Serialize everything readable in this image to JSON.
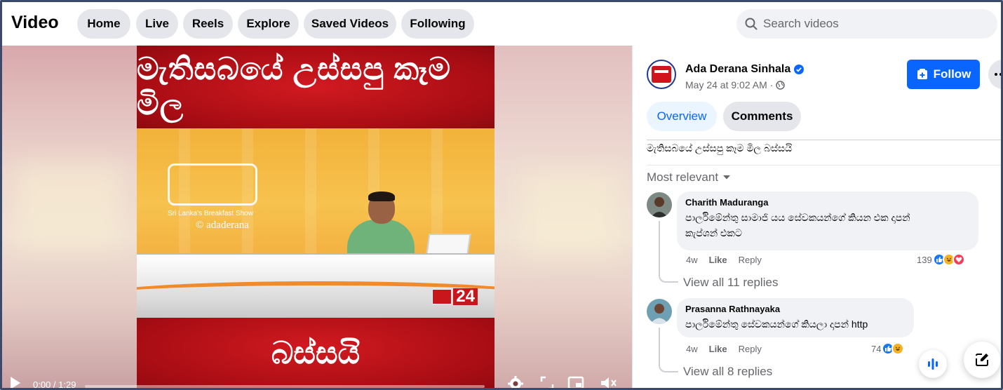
{
  "header": {
    "title": "Video",
    "nav": [
      {
        "label": "Home"
      },
      {
        "label": "Live"
      },
      {
        "label": "Reels"
      },
      {
        "label": "Explore"
      },
      {
        "label": "Saved Videos"
      },
      {
        "label": "Following"
      }
    ],
    "search_placeholder": "Search videos"
  },
  "video": {
    "headline_top": "මැතිසබයේ උස්සපු කෑම මිල",
    "headline_bottom": "බස්සයි",
    "show_tagline": "Sri Lanka's Breakfast Show",
    "watermark": "© adaderana",
    "channel_badge": "24",
    "time_display": "0:00 / 1:29",
    "progress": 0,
    "icons": [
      "play-icon",
      "settings-icon",
      "fullscreen-icon",
      "pip-icon",
      "volume-icon"
    ]
  },
  "post": {
    "page_name": "Ada Derana Sinhala",
    "date": "May 24 at 9:02 AM",
    "separator": "·",
    "follow_label": "Follow",
    "tabs": [
      {
        "label": "Overview",
        "active": true
      },
      {
        "label": "Comments",
        "active": false
      }
    ],
    "caption": "මැතිසබයේ උස්සපු කෑම මිල බස්සයි",
    "sort_label": "Most relevant"
  },
  "comments": [
    {
      "author": "Charith Maduranga",
      "text_line1": "පාර්ලිමේන්තු සාමාජි යය සේවකයන්ගේ කියන එක දාපන්",
      "text_line2": "කැප්ශන් එකට",
      "age": "4w",
      "like": "Like",
      "reply": "Reply",
      "reaction_count": "139",
      "reactions": [
        "like",
        "haha",
        "love"
      ],
      "view_replies": "View all 11 replies"
    },
    {
      "author": "Prasanna Rathnayaka",
      "text_line1": "පාර්ලිමේන්තු සේවකයන්ගේ කියලා දාපන් http",
      "age": "4w",
      "like": "Like",
      "reply": "Reply",
      "reaction_count": "74",
      "reactions": [
        "like",
        "haha"
      ],
      "view_replies": "View all 8 replies"
    }
  ],
  "colors": {
    "accent": "#0866ff",
    "pill_bg": "#e4e6eb",
    "headline_red": "#b5121b"
  }
}
